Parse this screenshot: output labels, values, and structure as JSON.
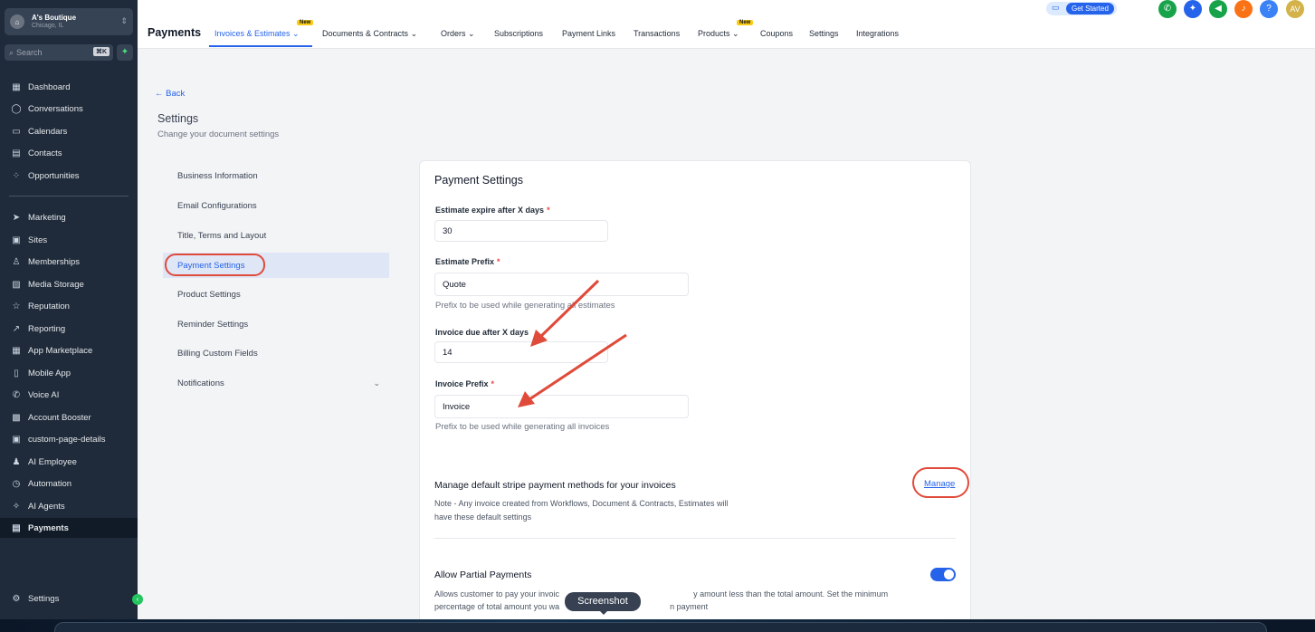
{
  "account": {
    "name": "A's Boutique",
    "location": "Chicago, IL"
  },
  "search": {
    "placeholder": "Search",
    "shortcut": "⌘K"
  },
  "sidebar": {
    "items": [
      {
        "label": "Dashboard",
        "icon": "grid-icon"
      },
      {
        "label": "Conversations",
        "icon": "chat-icon"
      },
      {
        "label": "Calendars",
        "icon": "calendar-icon"
      },
      {
        "label": "Contacts",
        "icon": "contacts-icon"
      },
      {
        "label": "Opportunities",
        "icon": "pipeline-icon"
      },
      {
        "label": "Marketing",
        "icon": "send-icon"
      },
      {
        "label": "Sites",
        "icon": "sites-icon"
      },
      {
        "label": "Memberships",
        "icon": "badge-icon"
      },
      {
        "label": "Media Storage",
        "icon": "image-icon"
      },
      {
        "label": "Reputation",
        "icon": "star-icon"
      },
      {
        "label": "Reporting",
        "icon": "trend-icon"
      },
      {
        "label": "App Marketplace",
        "icon": "apps-icon"
      },
      {
        "label": "Mobile App",
        "icon": "mobile-icon"
      },
      {
        "label": "Voice AI",
        "icon": "phone-icon"
      },
      {
        "label": "Account Booster",
        "icon": "chart-icon"
      },
      {
        "label": "custom-page-details",
        "icon": "page-icon"
      },
      {
        "label": "AI Employee",
        "icon": "person-icon"
      },
      {
        "label": "Automation",
        "icon": "automation-icon"
      },
      {
        "label": "AI Agents",
        "icon": "sparkle-icon"
      },
      {
        "label": "Payments",
        "icon": "receipt-icon"
      }
    ],
    "settings_label": "Settings"
  },
  "header": {
    "title": "Payments",
    "tabs": [
      {
        "label": "Invoices & Estimates"
      },
      {
        "label": "Documents & Contracts"
      },
      {
        "label": "Orders"
      },
      {
        "label": "Subscriptions"
      },
      {
        "label": "Payment Links"
      },
      {
        "label": "Transactions"
      },
      {
        "label": "Products"
      },
      {
        "label": "Coupons"
      },
      {
        "label": "Settings"
      },
      {
        "label": "Integrations"
      }
    ],
    "new_badge": "New",
    "get_started": "Get Started",
    "avatar_initials": "AV",
    "help_label": "?"
  },
  "page": {
    "back": "Back",
    "title": "Settings",
    "subtitle": "Change your document settings",
    "nav": [
      "Business Information",
      "Email Configurations",
      "Title, Terms and Layout",
      "Payment Settings",
      "Product Settings",
      "Reminder Settings",
      "Billing Custom Fields",
      "Notifications"
    ]
  },
  "card": {
    "title": "Payment Settings",
    "estimate_expire": {
      "label": "Estimate expire after X days",
      "value": "30"
    },
    "estimate_prefix": {
      "label": "Estimate Prefix",
      "value": "Quote",
      "help": "Prefix to be used while generating all estimates"
    },
    "invoice_due": {
      "label": "Invoice due after X days",
      "value": "14"
    },
    "invoice_prefix": {
      "label": "Invoice Prefix",
      "value": "Invoice",
      "help": "Prefix to be used while generating all invoices"
    },
    "stripe": {
      "title": "Manage default stripe payment methods for your invoices",
      "note_line1": "Note - Any invoice created from Workflows, Document & Contracts, Estimates will",
      "note_line2": "have these default settings",
      "manage": "Manage"
    },
    "partial": {
      "title": "Allow Partial Payments",
      "desc_line1": "Allows customer to pay your invoic",
      "desc_line1b": "y amount less than the total amount. Set the minimum",
      "desc_line2": "percentage of total amount you wa",
      "desc_line2b": "n payment",
      "enabled": true
    },
    "required_mark": "*"
  },
  "tooltip": "Screenshot",
  "colors": {
    "accent": "#2563eb",
    "sidebar": "#1f2b3a",
    "annotation": "#e04a3a"
  }
}
